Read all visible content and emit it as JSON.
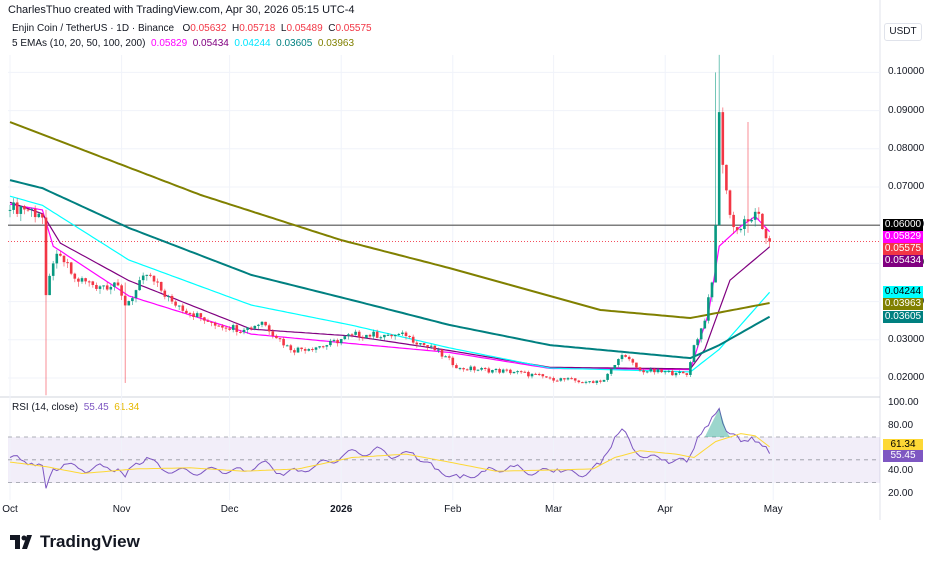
{
  "credit": "CharlesThuo created with TradingView.com, Apr 30, 2026 05:15 UTC-4",
  "symbol": {
    "name": "Enjin Coin / TetherUS · 1D · Binance",
    "o_label": "O",
    "o": "0.05632",
    "h_label": "H",
    "h": "0.05718",
    "l_label": "L",
    "l": "0.05489",
    "c_label": "C",
    "c": "0.05575"
  },
  "ema_legend": {
    "label": "5 EMAs (10, 20, 50, 100, 200)",
    "values": [
      "0.05829",
      "0.05434",
      "0.04244",
      "0.03605",
      "0.03963"
    ]
  },
  "rsi_legend": {
    "label": "RSI (14, close)",
    "rsi": "55.45",
    "ma": "61.34"
  },
  "currency": "USDT",
  "colors": {
    "up": "#089981",
    "down": "#f23645",
    "ema10": "#ff00ff",
    "ema20": "#800080",
    "ema50": "#00ffff",
    "ema100": "#008080",
    "ema200": "#808000",
    "rsi": "#7e57c2",
    "rsi_ma": "#fdd835"
  },
  "price_tags": [
    {
      "value": "0.06000",
      "bg": "#000000",
      "fg": "#ffffff",
      "price": 0.06
    },
    {
      "value": "0.05829",
      "bg": "#ff00ff",
      "fg": "#ffffff",
      "price": 0.05829
    },
    {
      "value": "0.05575",
      "bg": "#f23645",
      "fg": "#ffffff",
      "price": 0.05575
    },
    {
      "value": "0.05434",
      "bg": "#800080",
      "fg": "#ffffff",
      "price": 0.05434
    },
    {
      "value": "0.04244",
      "bg": "#00ffff",
      "fg": "#000000",
      "price": 0.04244
    },
    {
      "value": "0.03963",
      "bg": "#808000",
      "fg": "#ffffff",
      "price": 0.03963
    },
    {
      "value": "0.03605",
      "bg": "#008080",
      "fg": "#ffffff",
      "price": 0.03605
    }
  ],
  "rsi_tags": [
    {
      "value": "61.34",
      "bg": "#fdd835",
      "fg": "#000000",
      "level": 61.34
    },
    {
      "value": "55.45",
      "bg": "#7e57c2",
      "fg": "#ffffff",
      "level": 55.45
    }
  ],
  "chart_data": {
    "type": "candlestick",
    "title": "Enjin Coin / TetherUS · 1D · Binance",
    "x_ticks": [
      {
        "label": "Oct",
        "day": 0
      },
      {
        "label": "Nov",
        "day": 31
      },
      {
        "label": "Dec",
        "day": 61
      },
      {
        "label": "2026",
        "day": 92
      },
      {
        "label": "Feb",
        "day": 123
      },
      {
        "label": "Mar",
        "day": 151
      },
      {
        "label": "Apr",
        "day": 182
      },
      {
        "label": "May",
        "day": 212
      }
    ],
    "y_ticks": [
      "0.02000",
      "0.03000",
      "0.04000",
      "0.05000",
      "0.06000",
      "0.07000",
      "0.08000",
      "0.09000",
      "0.10000"
    ],
    "ylim": [
      0.0145,
      0.106
    ],
    "horizontal_line": 0.06,
    "close_anchors": [
      [
        0,
        0.064
      ],
      [
        3,
        0.065
      ],
      [
        8,
        0.063
      ],
      [
        9,
        0.062
      ],
      [
        10,
        0.0417
      ],
      [
        12,
        0.05
      ],
      [
        14,
        0.052
      ],
      [
        18,
        0.046
      ],
      [
        25,
        0.044
      ],
      [
        29,
        0.045
      ],
      [
        32,
        0.039
      ],
      [
        35,
        0.043
      ],
      [
        38,
        0.047
      ],
      [
        45,
        0.04
      ],
      [
        55,
        0.0347
      ],
      [
        65,
        0.0326
      ],
      [
        70,
        0.0347
      ],
      [
        78,
        0.0273
      ],
      [
        88,
        0.0286
      ],
      [
        95,
        0.0313
      ],
      [
        105,
        0.0313
      ],
      [
        110,
        0.031
      ],
      [
        118,
        0.0273
      ],
      [
        125,
        0.0226
      ],
      [
        140,
        0.0216
      ],
      [
        150,
        0.02
      ],
      [
        160,
        0.019
      ],
      [
        165,
        0.0195
      ],
      [
        170,
        0.026
      ],
      [
        175,
        0.022
      ],
      [
        185,
        0.0213
      ],
      [
        188,
        0.0208
      ],
      [
        190,
        0.0286
      ],
      [
        193,
        0.035
      ],
      [
        195,
        0.045
      ],
      [
        196,
        0.06
      ],
      [
        197,
        0.0896
      ],
      [
        198,
        0.0758
      ],
      [
        200,
        0.0627
      ],
      [
        202,
        0.0587
      ],
      [
        205,
        0.061
      ],
      [
        207,
        0.0635
      ],
      [
        209,
        0.059
      ],
      [
        211,
        0.05575
      ]
    ],
    "wicks": [
      [
        10,
        0.0155,
        0.064
      ],
      [
        32,
        0.0187,
        0.045
      ],
      [
        197,
        0.0604,
        0.1046
      ],
      [
        196,
        0.045,
        0.1
      ],
      [
        205,
        0.058,
        0.087
      ]
    ],
    "emas": [
      {
        "name": "EMA 10",
        "color": "#ff00ff",
        "points": [
          [
            0,
            0.0655
          ],
          [
            9,
            0.064
          ],
          [
            12,
            0.0545
          ],
          [
            33,
            0.0415
          ],
          [
            67,
            0.0315
          ],
          [
            95,
            0.029
          ],
          [
            122,
            0.0267
          ],
          [
            150,
            0.0225
          ],
          [
            189,
            0.0222
          ],
          [
            194,
            0.0368
          ],
          [
            197,
            0.0545
          ],
          [
            203,
            0.0597
          ],
          [
            207,
            0.0623
          ],
          [
            211,
            0.05829
          ]
        ]
      },
      {
        "name": "EMA 20",
        "color": "#800080",
        "points": [
          [
            0,
            0.066
          ],
          [
            9,
            0.063
          ],
          [
            14,
            0.0553
          ],
          [
            33,
            0.0455
          ],
          [
            67,
            0.0328
          ],
          [
            95,
            0.031
          ],
          [
            122,
            0.0272
          ],
          [
            150,
            0.0228
          ],
          [
            189,
            0.0224
          ],
          [
            193,
            0.0275
          ],
          [
            200,
            0.0456
          ],
          [
            211,
            0.05434
          ]
        ]
      },
      {
        "name": "EMA 50",
        "color": "#00ffff",
        "points": [
          [
            0,
            0.0676
          ],
          [
            9,
            0.0652
          ],
          [
            33,
            0.0509
          ],
          [
            67,
            0.0391
          ],
          [
            95,
            0.0338
          ],
          [
            122,
            0.0279
          ],
          [
            150,
            0.0226
          ],
          [
            189,
            0.0216
          ],
          [
            197,
            0.0275
          ],
          [
            211,
            0.04244
          ]
        ]
      },
      {
        "name": "EMA 100",
        "color": "#008080",
        "points": [
          [
            0,
            0.0718
          ],
          [
            9,
            0.0697
          ],
          [
            33,
            0.0593
          ],
          [
            67,
            0.047
          ],
          [
            95,
            0.0404
          ],
          [
            122,
            0.0339
          ],
          [
            150,
            0.0286
          ],
          [
            189,
            0.0252
          ],
          [
            197,
            0.0286
          ],
          [
            211,
            0.03605
          ]
        ]
      },
      {
        "name": "EMA 200",
        "color": "#808000",
        "points": [
          [
            0,
            0.087
          ],
          [
            53,
            0.0679
          ],
          [
            92,
            0.0561
          ],
          [
            122,
            0.0488
          ],
          [
            164,
            0.0378
          ],
          [
            189,
            0.0357
          ],
          [
            211,
            0.03963
          ]
        ]
      }
    ],
    "rsi": {
      "y_ticks": [
        "20.00",
        "40.00",
        "60.00",
        "80.00",
        "100.00"
      ],
      "ylim": [
        18,
        102
      ],
      "bands": [
        30,
        50,
        70
      ],
      "rsi_points": [
        [
          0,
          52
        ],
        [
          3,
          50
        ],
        [
          6,
          47
        ],
        [
          9,
          45
        ],
        [
          10,
          25
        ],
        [
          12,
          42
        ],
        [
          15,
          46
        ],
        [
          20,
          41
        ],
        [
          26,
          44
        ],
        [
          30,
          42
        ],
        [
          32,
          35
        ],
        [
          35,
          47
        ],
        [
          38,
          52
        ],
        [
          42,
          42
        ],
        [
          50,
          39
        ],
        [
          58,
          41
        ],
        [
          65,
          40
        ],
        [
          70,
          48
        ],
        [
          75,
          38
        ],
        [
          80,
          40
        ],
        [
          85,
          45
        ],
        [
          92,
          52
        ],
        [
          96,
          58
        ],
        [
          100,
          55
        ],
        [
          103,
          60
        ],
        [
          107,
          52
        ],
        [
          112,
          56
        ],
        [
          118,
          42
        ],
        [
          125,
          34
        ],
        [
          132,
          40
        ],
        [
          140,
          44
        ],
        [
          146,
          38
        ],
        [
          152,
          42
        ],
        [
          158,
          36
        ],
        [
          164,
          46
        ],
        [
          168,
          70
        ],
        [
          170,
          77
        ],
        [
          173,
          60
        ],
        [
          177,
          52
        ],
        [
          182,
          50
        ],
        [
          188,
          48
        ],
        [
          191,
          70
        ],
        [
          194,
          80
        ],
        [
          197,
          95
        ],
        [
          199,
          75
        ],
        [
          203,
          66
        ],
        [
          206,
          70
        ],
        [
          209,
          62
        ],
        [
          211,
          55.45
        ]
      ],
      "ma_points": [
        [
          0,
          48
        ],
        [
          10,
          44
        ],
        [
          20,
          38
        ],
        [
          35,
          42
        ],
        [
          50,
          43
        ],
        [
          65,
          40
        ],
        [
          80,
          42
        ],
        [
          95,
          52
        ],
        [
          110,
          55
        ],
        [
          122,
          48
        ],
        [
          135,
          40
        ],
        [
          150,
          41
        ],
        [
          162,
          42
        ],
        [
          168,
          52
        ],
        [
          175,
          58
        ],
        [
          185,
          55
        ],
        [
          190,
          52
        ],
        [
          196,
          66
        ],
        [
          203,
          73
        ],
        [
          207,
          71
        ],
        [
          211,
          61.34
        ]
      ]
    }
  }
}
